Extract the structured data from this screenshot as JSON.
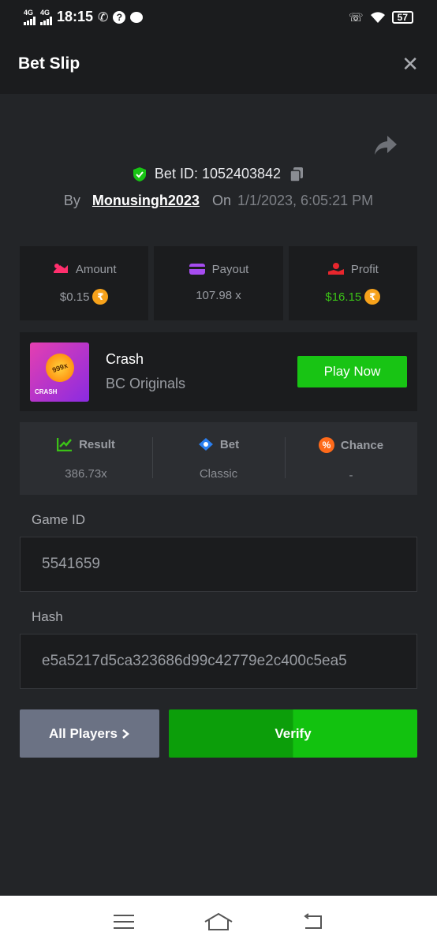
{
  "status_bar": {
    "time": "18:15",
    "net1": "4G",
    "net2": "4G",
    "battery": "57"
  },
  "header": {
    "title": "Bet Slip"
  },
  "bet": {
    "id_text": "Bet ID: 1052403842",
    "by_label": "By",
    "username": "Monusingh2023",
    "on_label": "On",
    "date": "1/1/2023, 6:05:21 PM"
  },
  "stats": {
    "amount_label": "Amount",
    "amount_value": "$0.15",
    "payout_label": "Payout",
    "payout_value": "107.98 x",
    "profit_label": "Profit",
    "profit_value": "$16.15",
    "coin_symbol": "₹"
  },
  "game": {
    "name": "Crash",
    "provider": "BC Originals",
    "thumb_multiplier": "999x",
    "thumb_tag": "CRASH",
    "play_label": "Play Now"
  },
  "result": {
    "result_label": "Result",
    "result_value": "386.73x",
    "bet_label": "Bet",
    "bet_value": "Classic",
    "chance_label": "Chance",
    "chance_value": "-"
  },
  "game_id": {
    "label": "Game ID",
    "value": "5541659"
  },
  "hash": {
    "label": "Hash",
    "value": "e5a5217d5ca323686d99c42779e2c400c5ea5"
  },
  "buttons": {
    "all_players": "All Players",
    "verify": "Verify"
  },
  "colors": {
    "accent_green": "#18c414",
    "profit_green": "#3bc117",
    "panel": "#1b1c1e",
    "background": "#232528"
  },
  "icons": [
    "close-icon",
    "share-icon",
    "shield-check-icon",
    "copy-icon",
    "amount-icon",
    "wallet-icon",
    "profit-icon",
    "coin-icon",
    "result-icon",
    "bet-icon",
    "chance-icon",
    "chevron-right-icon",
    "menu-icon",
    "home-icon",
    "back-icon"
  ]
}
